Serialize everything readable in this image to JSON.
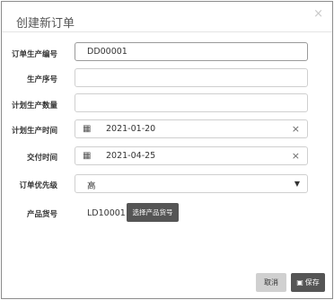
{
  "dialog": {
    "title": "创建新订单",
    "close_icon": "close-icon"
  },
  "form": {
    "order_no": {
      "label": "订单生产编号",
      "value": "DD00001"
    },
    "seq_no": {
      "label": "生产序号",
      "value": ""
    },
    "plan_qty": {
      "label": "计划生产数量",
      "value": ""
    },
    "plan_time": {
      "label": "计划生产时间",
      "value": "2021-01-20",
      "icon": "calendar-icon",
      "clear": "×"
    },
    "delivery_time": {
      "label": "交付时间",
      "value": "2021-04-25",
      "icon": "calendar-icon",
      "clear": "×"
    },
    "priority": {
      "label": "订单优先级",
      "value": "高",
      "arrow": "▼"
    },
    "product_code": {
      "label": "产品货号",
      "value": "LD10001",
      "button": "选择产品货号"
    }
  },
  "footer": {
    "cancel_label": "取消",
    "save_label": "保存",
    "save_icon": "save-icon"
  }
}
